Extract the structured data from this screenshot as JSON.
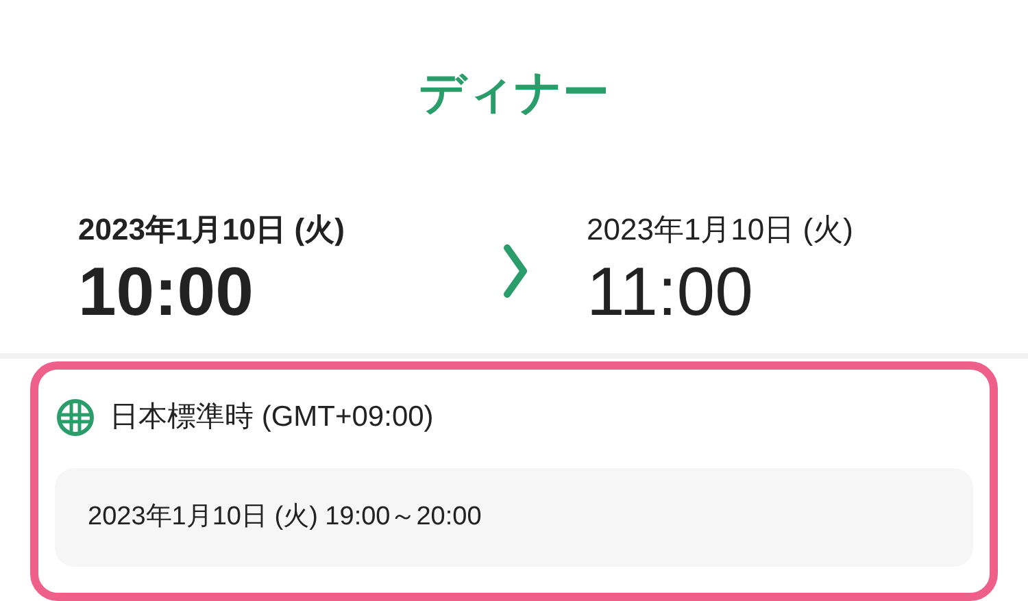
{
  "title": "ディナー",
  "start": {
    "date": "2023年1月10日 (火)",
    "time": "10:00"
  },
  "end": {
    "date": "2023年1月10日 (火)",
    "time": "11:00"
  },
  "timezone": {
    "label": "日本標準時 (GMT+09:00)",
    "converted": "2023年1月10日 (火) 19:00～20:00"
  }
}
